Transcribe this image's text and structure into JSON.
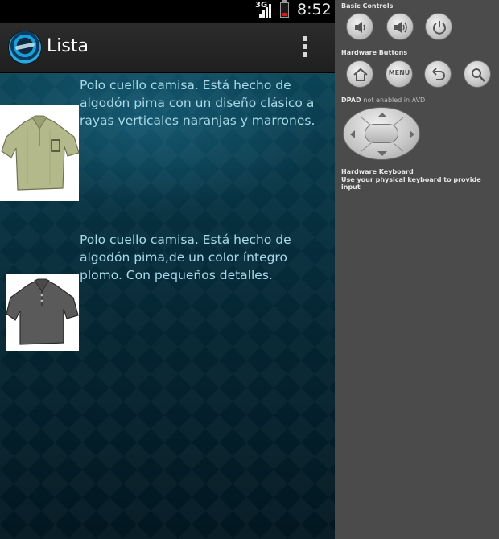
{
  "status_bar": {
    "network": "3G",
    "time": "8:52"
  },
  "action_bar": {
    "title": "Lista",
    "icons": {
      "app": "app-logo-icon",
      "overflow": "overflow-menu-icon"
    }
  },
  "list": {
    "items": [
      {
        "image": "green-polo-shirt-image",
        "description": "Polo cuello camisa. Está hecho de algodón pima con un diseño clásico a rayas verticales naranjas y marrones."
      },
      {
        "image": "gray-polo-shirt-image",
        "description": "Polo cuello camisa. Está hecho de algodón pima,de un color íntegro plomo. Con pequeños detalles."
      }
    ]
  },
  "emulator": {
    "basic_controls_label": "Basic Controls",
    "basic_controls": [
      "volume-down-icon",
      "volume-up-icon",
      "power-icon"
    ],
    "hardware_buttons_label": "Hardware Buttons",
    "hardware_buttons": {
      "home": "home-icon",
      "menu_label": "MENU",
      "back": "back-icon",
      "search": "search-icon"
    },
    "dpad_label": "DPAD",
    "dpad_note": "not enabled in AVD",
    "keyboard_title": "Hardware Keyboard",
    "keyboard_subtitle": "Use your physical keyboard to provide input"
  },
  "colors": {
    "accent_text": "#a9d8e6",
    "action_bar": "#262626",
    "emulator_panel": "#4b4b4b",
    "battery": "#d21b1b"
  }
}
